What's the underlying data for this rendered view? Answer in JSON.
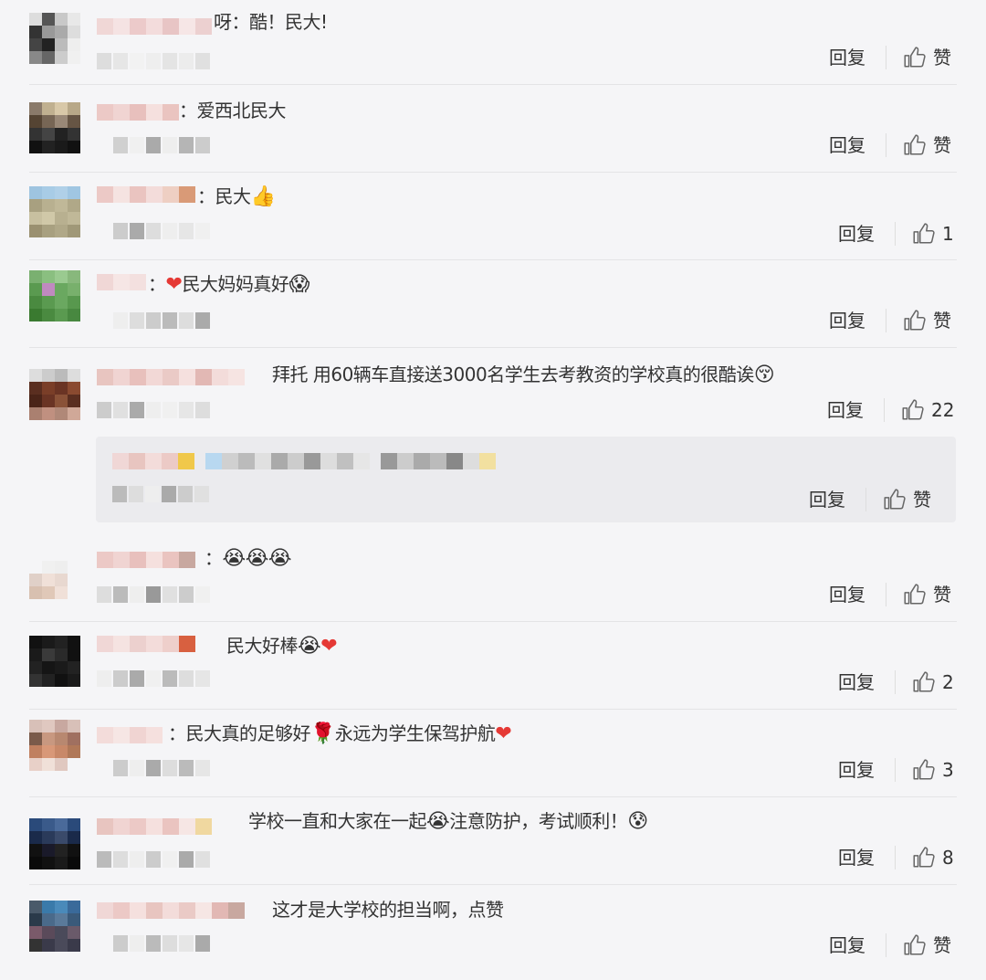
{
  "actions": {
    "reply_label": "回复",
    "like_label": "赞"
  },
  "comments": [
    {
      "text": "呀：酷！民大!",
      "likes": "赞"
    },
    {
      "text": "：爱西北民大",
      "likes": "赞"
    },
    {
      "text": "：民大",
      "emoji": "👍",
      "likes": "1"
    },
    {
      "text": "民大妈妈真好",
      "emoji": "😱",
      "likes": "赞"
    },
    {
      "text": "拜托 用60辆车直接送3000名学生去考教资的学校真的很酷诶",
      "emoji": "😚",
      "likes": "22"
    },
    {
      "text": "：",
      "emoji": "😭😭😭",
      "likes": "赞"
    },
    {
      "text": "民大好棒",
      "emoji": "😭",
      "likes": "2"
    },
    {
      "text": "：民大真的足够好",
      "emoji": "🌹",
      "text2": "永远为学生保驾护航",
      "likes": "3"
    },
    {
      "text": "学校一直和大家在一起",
      "emoji": "😭",
      "text2": "注意防护，考试顺利！",
      "emoji2": "😰",
      "likes": "8"
    },
    {
      "text": "这才是大学校的担当啊，点赞",
      "likes": "赞"
    }
  ],
  "sub_reply": {
    "likes": "赞"
  },
  "colors": {
    "heart": "#e53935",
    "background": "#f5f5f7",
    "sub_reply_bg": "#ebebee"
  }
}
